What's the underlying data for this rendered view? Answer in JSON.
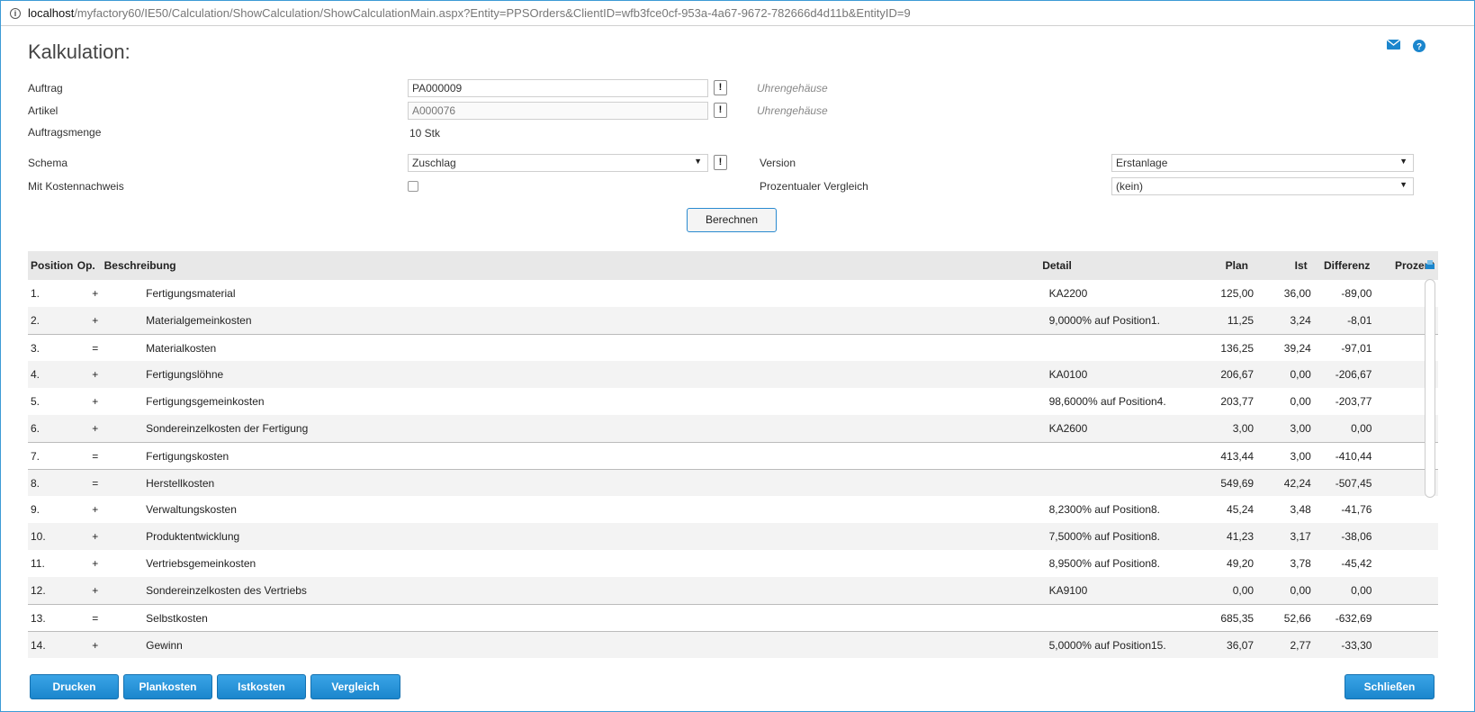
{
  "browser": {
    "url_host": "localhost",
    "url_path": "/myfactory60/IE50/Calculation/ShowCalculation/ShowCalculationMain.aspx?Entity=PPSOrders&ClientID=wfb3fce0cf-953a-4a67-9672-782666d4d11b&EntityID=9"
  },
  "page": {
    "title": "Kalkulation:"
  },
  "form": {
    "auftrag_label": "Auftrag",
    "auftrag_value": "PA000009",
    "auftrag_hint": "Uhrengehäuse",
    "artikel_label": "Artikel",
    "artikel_value": "A000076",
    "artikel_hint": "Uhrengehäuse",
    "menge_label": "Auftragsmenge",
    "menge_value": "10 Stk",
    "schema_label": "Schema",
    "schema_value": "Zuschlag",
    "kosten_label": "Mit Kostennachweis",
    "version_label": "Version",
    "version_value": "Erstanlage",
    "vergleich_label": "Prozentualer Vergleich",
    "vergleich_value": "(kein)",
    "excl": "!",
    "calc_button": "Berechnen"
  },
  "grid": {
    "headers": {
      "pos": "Position",
      "op": "Op.",
      "desc": "Beschreibung",
      "detail": "Detail",
      "plan": "Plan",
      "ist": "Ist",
      "diff": "Differenz",
      "proz": "Prozent"
    },
    "rows": [
      {
        "pos": "1.",
        "op": "+",
        "desc": "Fertigungsmaterial",
        "detail": "KA2200",
        "plan": "125,00",
        "ist": "36,00",
        "diff": "-89,00"
      },
      {
        "pos": "2.",
        "op": "+",
        "desc": "Materialgemeinkosten",
        "detail": "9,0000% auf Position1.",
        "plan": "11,25",
        "ist": "3,24",
        "diff": "-8,01"
      },
      {
        "pos": "3.",
        "op": "=",
        "desc": "Materialkosten",
        "detail": "",
        "plan": "136,25",
        "ist": "39,24",
        "diff": "-97,01"
      },
      {
        "pos": "4.",
        "op": "+",
        "desc": "Fertigungslöhne",
        "detail": "KA0100",
        "plan": "206,67",
        "ist": "0,00",
        "diff": "-206,67"
      },
      {
        "pos": "5.",
        "op": "+",
        "desc": "Fertigungsgemeinkosten",
        "detail": "98,6000% auf Position4.",
        "plan": "203,77",
        "ist": "0,00",
        "diff": "-203,77"
      },
      {
        "pos": "6.",
        "op": "+",
        "desc": "Sondereinzelkosten der Fertigung",
        "detail": "KA2600",
        "plan": "3,00",
        "ist": "3,00",
        "diff": "0,00"
      },
      {
        "pos": "7.",
        "op": "=",
        "desc": "Fertigungskosten",
        "detail": "",
        "plan": "413,44",
        "ist": "3,00",
        "diff": "-410,44"
      },
      {
        "pos": "8.",
        "op": "=",
        "desc": "Herstellkosten",
        "detail": "",
        "plan": "549,69",
        "ist": "42,24",
        "diff": "-507,45"
      },
      {
        "pos": "9.",
        "op": "+",
        "desc": "Verwaltungskosten",
        "detail": "8,2300% auf Position8.",
        "plan": "45,24",
        "ist": "3,48",
        "diff": "-41,76"
      },
      {
        "pos": "10.",
        "op": "+",
        "desc": "Produktentwicklung",
        "detail": "7,5000% auf Position8.",
        "plan": "41,23",
        "ist": "3,17",
        "diff": "-38,06"
      },
      {
        "pos": "11.",
        "op": "+",
        "desc": "Vertriebsgemeinkosten",
        "detail": "8,9500% auf Position8.",
        "plan": "49,20",
        "ist": "3,78",
        "diff": "-45,42"
      },
      {
        "pos": "12.",
        "op": "+",
        "desc": "Sondereinzelkosten des Vertriebs",
        "detail": "KA9100",
        "plan": "0,00",
        "ist": "0,00",
        "diff": "0,00"
      },
      {
        "pos": "13.",
        "op": "=",
        "desc": "Selbstkosten",
        "detail": "",
        "plan": "685,35",
        "ist": "52,66",
        "diff": "-632,69"
      },
      {
        "pos": "14.",
        "op": "+",
        "desc": "Gewinn",
        "detail": "5,0000% auf Position15.",
        "plan": "36,07",
        "ist": "2,77",
        "diff": "-33,30"
      }
    ]
  },
  "footer": {
    "drucken": "Drucken",
    "plankosten": "Plankosten",
    "istkosten": "Istkosten",
    "vergleich": "Vergleich",
    "schliessen": "Schließen"
  },
  "colors": {
    "accent": "#1b86cd",
    "frame": "#3d9bd6"
  }
}
